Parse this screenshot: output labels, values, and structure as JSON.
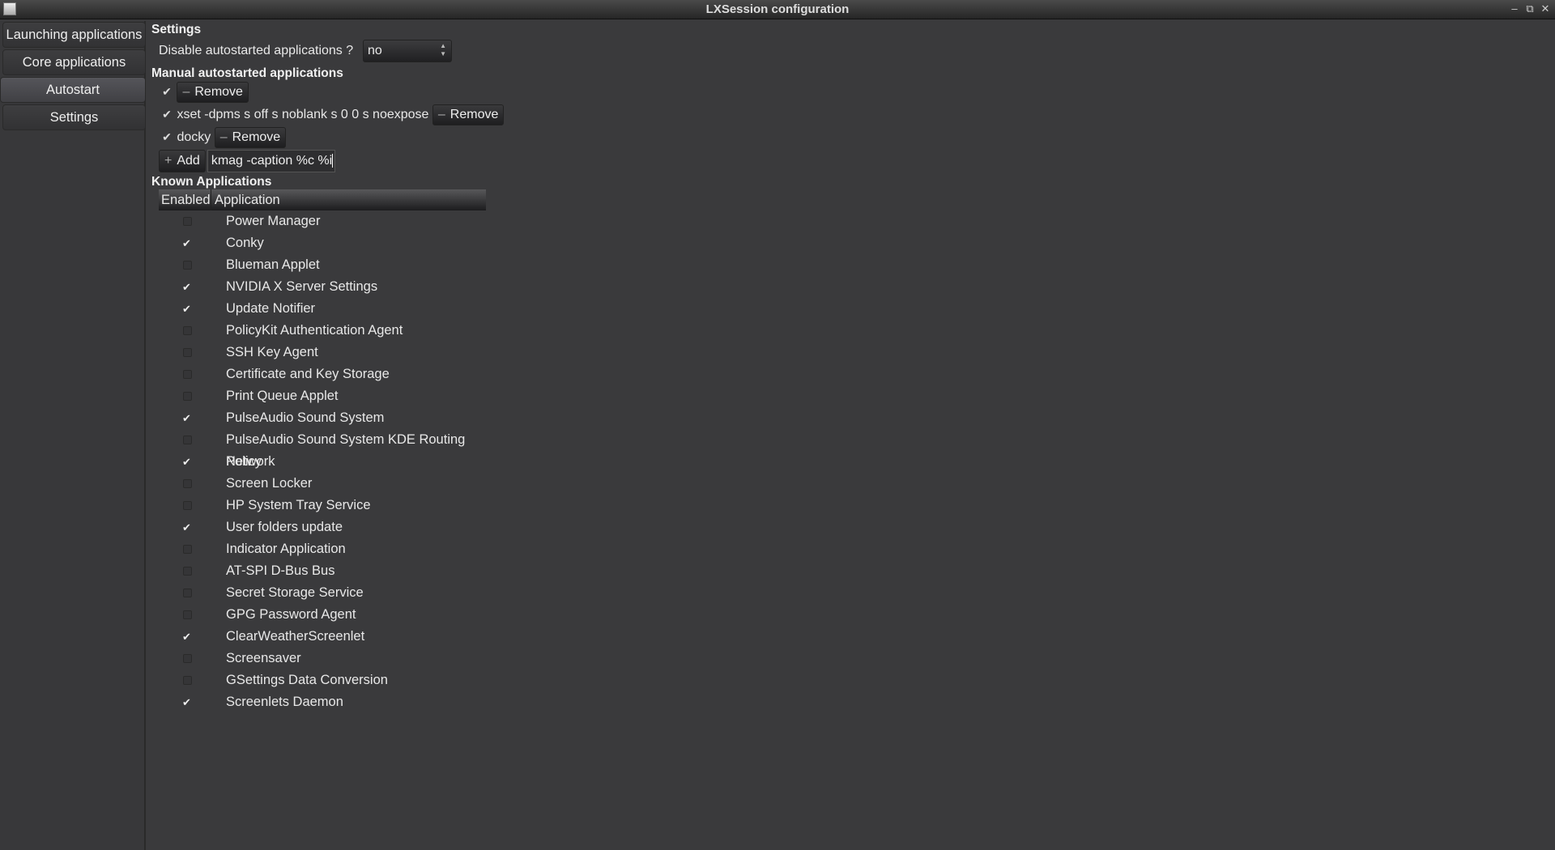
{
  "window": {
    "title": "LXSession configuration",
    "minimize": "–",
    "restore": "⧉",
    "close": "✕"
  },
  "sidebar": {
    "items": [
      {
        "label": "Launching applications"
      },
      {
        "label": "Core applications"
      },
      {
        "label": "Autostart",
        "active": true
      },
      {
        "label": "Settings"
      }
    ]
  },
  "settings": {
    "heading": "Settings",
    "disable_label": "Disable autostarted applications ?",
    "disable_value": "no"
  },
  "manual": {
    "heading": "Manual autostarted applications",
    "remove_label": "Remove",
    "items": [
      {
        "name": "",
        "checked": true
      },
      {
        "name": "xset -dpms s off s noblank s 0 0 s noexpose",
        "checked": true
      },
      {
        "name": "docky",
        "checked": true
      }
    ],
    "add_label": "Add",
    "add_input": "kmag -caption %c %i"
  },
  "known": {
    "heading": "Known Applications",
    "columns": [
      "Enabled",
      "Application"
    ],
    "items": [
      {
        "name": "Power Manager",
        "enabled": false
      },
      {
        "name": "Conky",
        "enabled": true
      },
      {
        "name": "Blueman Applet",
        "enabled": false
      },
      {
        "name": "NVIDIA X Server Settings",
        "enabled": true
      },
      {
        "name": "Update Notifier",
        "enabled": true
      },
      {
        "name": "PolicyKit Authentication Agent",
        "enabled": false
      },
      {
        "name": "SSH Key Agent",
        "enabled": false
      },
      {
        "name": "Certificate and Key Storage",
        "enabled": false
      },
      {
        "name": "Print Queue Applet",
        "enabled": false
      },
      {
        "name": "PulseAudio Sound System",
        "enabled": true
      },
      {
        "name": "PulseAudio Sound System KDE Routing Policy",
        "enabled": false
      },
      {
        "name": "Network",
        "enabled": true
      },
      {
        "name": "Screen Locker",
        "enabled": false
      },
      {
        "name": "HP System Tray Service",
        "enabled": false
      },
      {
        "name": "User folders update",
        "enabled": true
      },
      {
        "name": "Indicator Application",
        "enabled": false
      },
      {
        "name": "AT-SPI D-Bus Bus",
        "enabled": false
      },
      {
        "name": "Secret Storage Service",
        "enabled": false
      },
      {
        "name": "GPG Password Agent",
        "enabled": false
      },
      {
        "name": "ClearWeatherScreenlet",
        "enabled": true
      },
      {
        "name": "Screensaver",
        "enabled": false
      },
      {
        "name": "GSettings Data Conversion",
        "enabled": false
      },
      {
        "name": "Screenlets Daemon",
        "enabled": true
      }
    ]
  }
}
